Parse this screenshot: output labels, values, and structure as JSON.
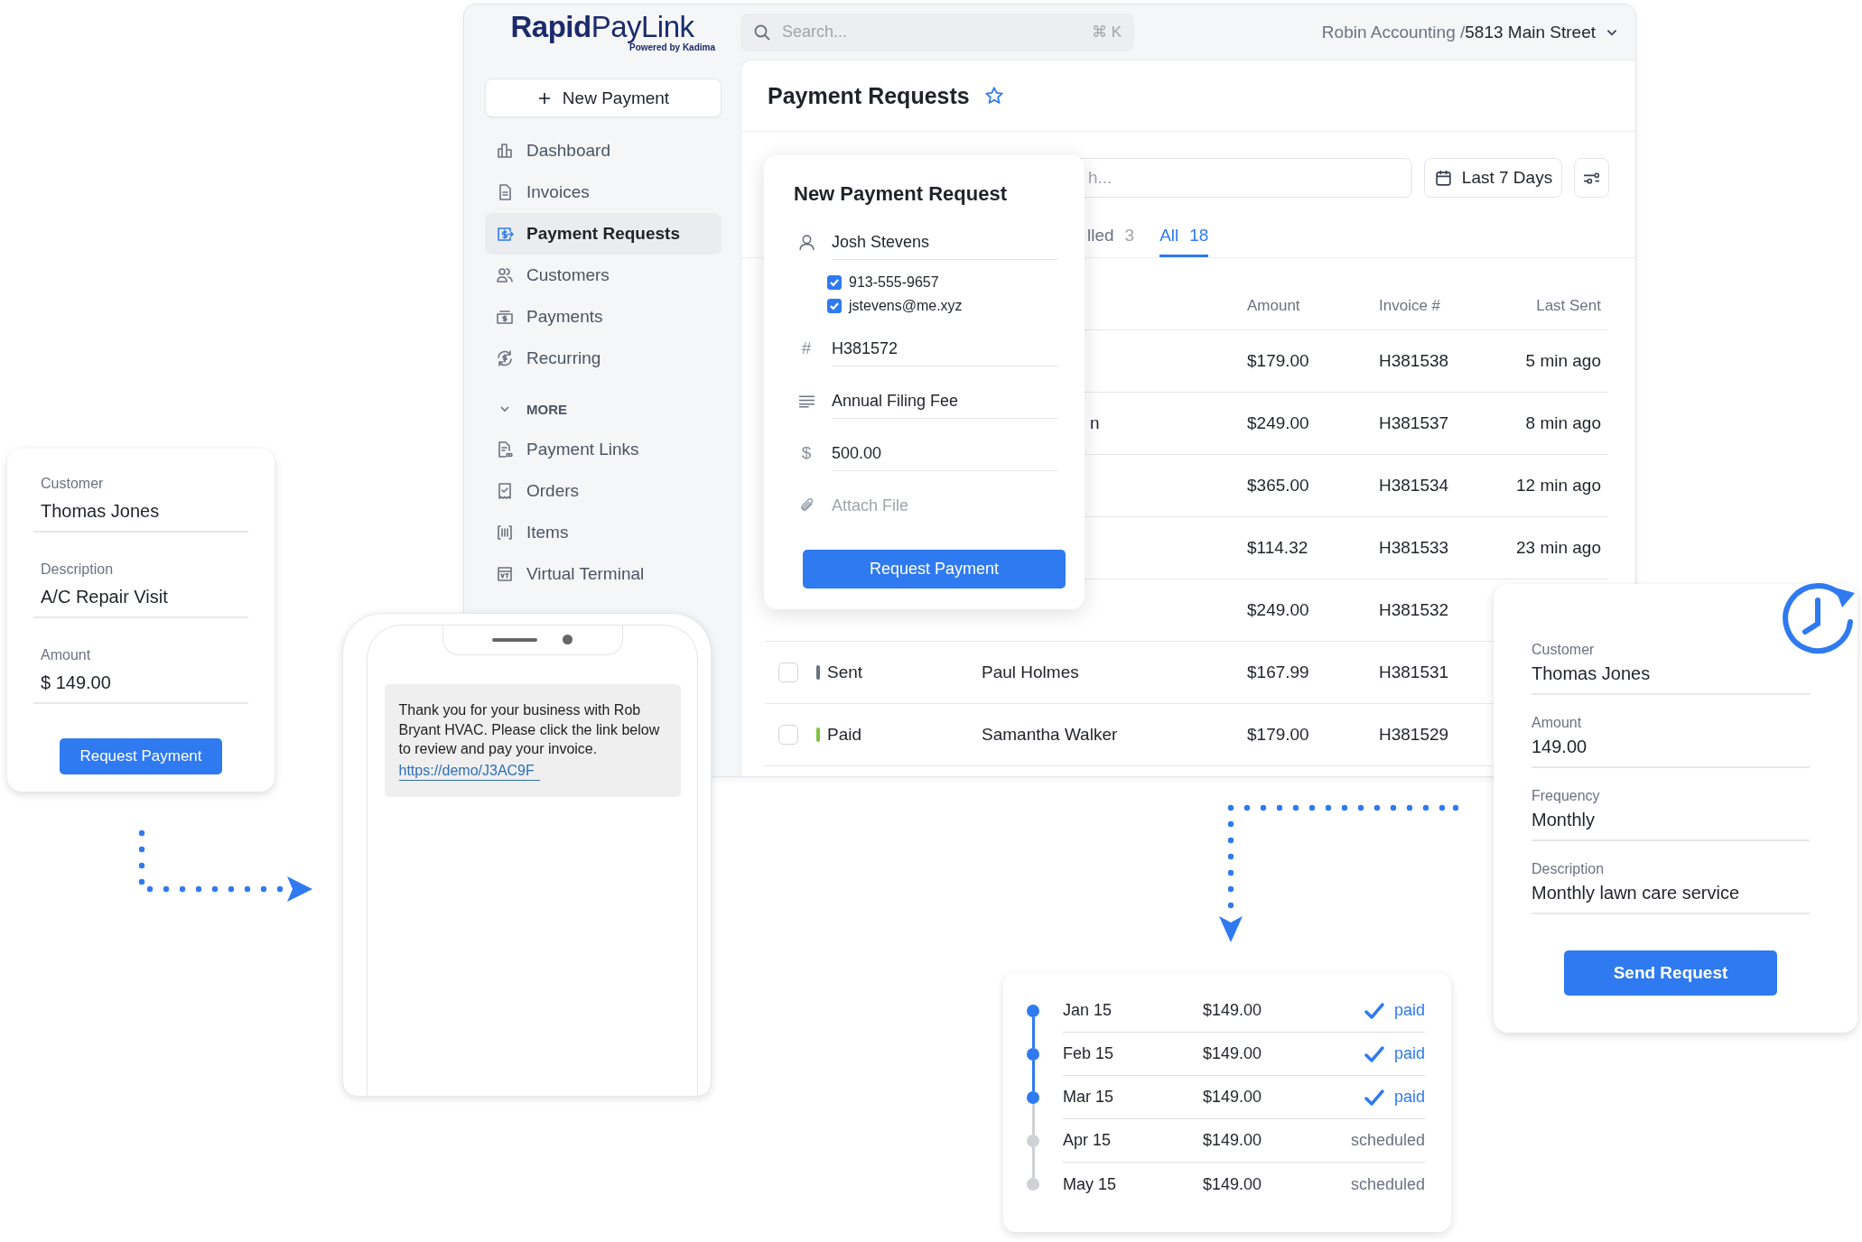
{
  "app": {
    "logo": {
      "brand_bold": "Rapid",
      "brand_light": "PayLink",
      "tagline": "Powered by Kadima"
    },
    "search": {
      "placeholder": "Search...",
      "shortcut": "⌘ K"
    },
    "account": {
      "organization": "Robin Accounting /",
      "location": "5813 Main Street"
    },
    "new_payment_button": "New Payment",
    "sidebar": {
      "items": [
        {
          "label": "Dashboard",
          "kind": "dashboard",
          "selected": false
        },
        {
          "label": "Invoices",
          "kind": "invoice",
          "selected": false
        },
        {
          "label": "Payment Requests",
          "kind": "request",
          "selected": true
        },
        {
          "label": "Customers",
          "kind": "customers",
          "selected": false
        },
        {
          "label": "Payments",
          "kind": "payments",
          "selected": false
        },
        {
          "label": "Recurring",
          "kind": "recurring",
          "selected": false
        }
      ],
      "more": {
        "label": "MORE",
        "expanded": true,
        "items": [
          {
            "label": "Payment Links",
            "kind": "links",
            "selected": false
          },
          {
            "label": "Orders",
            "kind": "orders",
            "selected": false
          },
          {
            "label": "Items",
            "kind": "items",
            "selected": false
          },
          {
            "label": "Virtual Terminal",
            "kind": "terminal",
            "selected": false
          }
        ]
      }
    },
    "page_title": "Payment Requests",
    "toolbar": {
      "search_placeholder": "h...",
      "date_range": "Last 7 Days"
    },
    "tabs": [
      {
        "label": "lled",
        "count": "3",
        "selected": false
      },
      {
        "label": "All",
        "count": "18",
        "selected": true
      }
    ],
    "table": {
      "columns": [
        "Amount",
        "Invoice #",
        "Last Sent"
      ],
      "rows": [
        {
          "kind": "covered",
          "amount": "$179.00",
          "invoice": "H381538",
          "last_sent": "5 min ago"
        },
        {
          "kind": "covered",
          "customer": "n",
          "amount": "$249.00",
          "invoice": "H381537",
          "last_sent": "8 min ago"
        },
        {
          "kind": "covered",
          "amount": "$365.00",
          "invoice": "H381534",
          "last_sent": "12 min ago"
        },
        {
          "kind": "covered",
          "amount": "$114.32",
          "invoice": "H381533",
          "last_sent": "23 min ago"
        },
        {
          "kind": "covered",
          "amount": "$249.00",
          "invoice": "H381532"
        },
        {
          "kind": "full",
          "checked": false,
          "status": "Sent",
          "color": "#6b7280",
          "customer": "Paul Holmes",
          "amount": "$167.99",
          "invoice": "H381531"
        },
        {
          "kind": "full",
          "checked": false,
          "status": "Paid",
          "color": "#7cc242",
          "customer": "Samantha Walker",
          "amount": "$179.00",
          "invoice": "H381529"
        }
      ]
    }
  },
  "request_dialog": {
    "title": "New Payment Request",
    "fields": [
      {
        "kind": "person",
        "value": "Josh Stevens",
        "contacts": [
          {
            "label": "913-555-9657",
            "checked": true
          },
          {
            "label": "jstevens@me.xyz",
            "checked": true
          }
        ]
      },
      {
        "kind": "symbol",
        "symbol": "#",
        "value": "H381572"
      },
      {
        "kind": "lines",
        "value": "Annual Filing Fee"
      },
      {
        "kind": "symbol",
        "symbol": "$",
        "value": "500.00"
      },
      {
        "kind": "attachment",
        "placeholder": "Attach File"
      }
    ],
    "button": "Request Payment"
  },
  "quick_request_card": {
    "fields": [
      {
        "label": "Customer",
        "value": "Thomas Jones"
      },
      {
        "label": "Description",
        "value": "A/C Repair Visit"
      },
      {
        "label": "Amount",
        "value": "$ 149.00"
      }
    ],
    "button": "Request Payment"
  },
  "phone_message": {
    "text": "Thank you for your business with Rob Bryant HVAC. Please click the link below to review and pay your invoice.",
    "link": "https://demo/J3AC9F"
  },
  "schedule": [
    {
      "date": "Jan 15",
      "amount": "$149.00",
      "status": "paid",
      "completed": true
    },
    {
      "date": "Feb 15",
      "amount": "$149.00",
      "status": "paid",
      "completed": true
    },
    {
      "date": "Mar 15",
      "amount": "$149.00",
      "status": "paid",
      "completed": true
    },
    {
      "date": "Apr 15",
      "amount": "$149.00",
      "status": "scheduled",
      "completed": false
    },
    {
      "date": "May 15",
      "amount": "$149.00",
      "status": "scheduled",
      "completed": false
    }
  ],
  "recurring_card": {
    "fields": [
      {
        "label": "Customer",
        "value": "Thomas Jones"
      },
      {
        "label": "Amount",
        "value": "149.00"
      },
      {
        "label": "Frequency",
        "value": "Monthly"
      },
      {
        "label": "Description",
        "value": "Monthly lawn care service"
      }
    ],
    "button": "Send Request"
  }
}
